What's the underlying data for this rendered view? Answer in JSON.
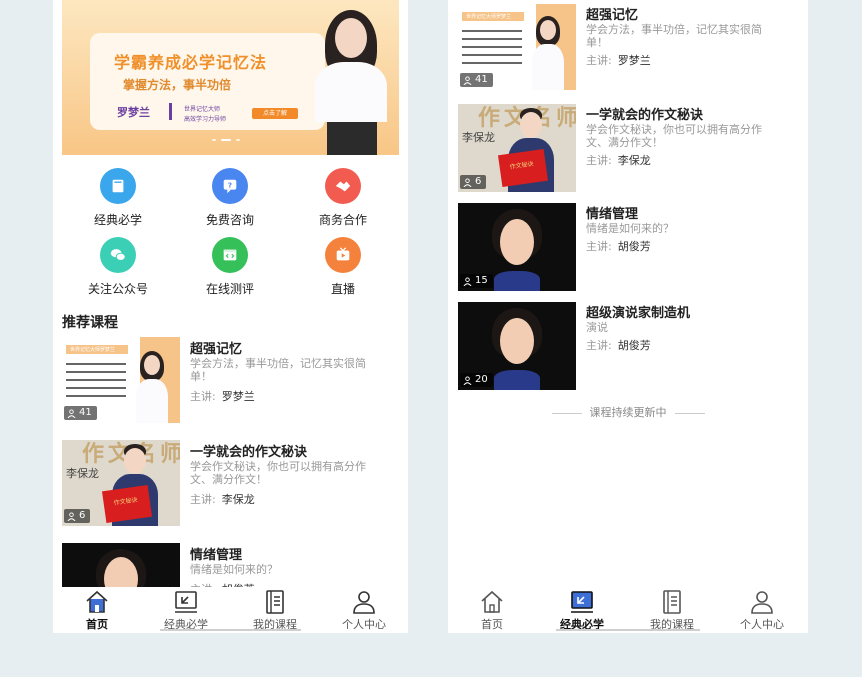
{
  "colors": {
    "background": "#e6eef1",
    "accent_orange": "#f28a2a",
    "nav_active": "#3d6fd6"
  },
  "banner": {
    "title": "学霸养成必学记忆法",
    "subtitle": "掌握方法，事半功倍",
    "name": "罗梦兰",
    "tag_line1": "世界记忆大师",
    "tag_line2": "高效学习力导师",
    "button": "点击了解"
  },
  "grid": [
    {
      "label": "经典必学",
      "icon": "book-icon",
      "color": "#3aa6ec"
    },
    {
      "label": "免费咨询",
      "icon": "consult-icon",
      "color": "#4a86f0"
    },
    {
      "label": "商务合作",
      "icon": "handshake-icon",
      "color": "#f25b4f"
    },
    {
      "label": "关注公众号",
      "icon": "wechat-icon",
      "color": "#3bd0b6"
    },
    {
      "label": "在线测评",
      "icon": "code-window-icon",
      "color": "#35c05a"
    },
    {
      "label": "直播",
      "icon": "tv-icon",
      "color": "#f5823c"
    }
  ],
  "section_title": "推荐课程",
  "teacher_prefix": "主讲:",
  "courses": [
    {
      "title": "超强记忆",
      "desc": "学会方法，事半功倍，记忆其实很简单！",
      "teacher": "罗梦兰",
      "count": "41",
      "thumb_strip": "世界记忆大师罗梦兰"
    },
    {
      "title": "一学就会的作文秘诀",
      "desc": "学会作文秘诀，你也可以拥有高分作文、满分作文！",
      "teacher": "李保龙",
      "count": "6",
      "thumb_name": "李保龙",
      "thumb_big": "作文名师",
      "thumb_book": "作文秘诀"
    },
    {
      "title": "情绪管理",
      "desc": "情绪是如何来的？",
      "teacher": "胡俊芳",
      "count": "15"
    },
    {
      "title": "超级演说家制造机",
      "desc": "演说",
      "teacher": "胡俊芳",
      "count": "20"
    }
  ],
  "footer_note": "课程持续更新中",
  "nav": [
    {
      "label": "首页",
      "icon": "home-icon"
    },
    {
      "label": "经典必学",
      "icon": "classic-icon"
    },
    {
      "label": "我的课程",
      "icon": "my-courses-icon"
    },
    {
      "label": "个人中心",
      "icon": "profile-icon"
    }
  ]
}
